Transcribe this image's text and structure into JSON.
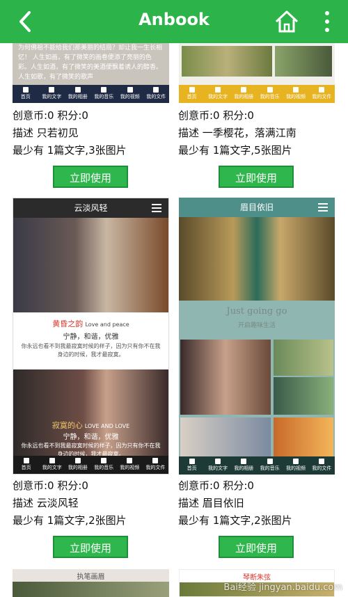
{
  "app": {
    "title": "Anbook"
  },
  "colors": {
    "header": "#2cb34a",
    "button": "#2fb64c"
  },
  "icons": {
    "back": "chevron-left-icon",
    "home": "home-icon",
    "more": "more-vert-icon"
  },
  "template_nav": [
    "首页",
    "我的文字",
    "我的相册",
    "我的音乐",
    "我的视频",
    "我的文件"
  ],
  "top_partial_text": "为何佛祖不能给我们那美丽的结局？却让我一生长相忆！ 人生如画，有了微笑的画卷便添了亮丽的色彩。人生如酒，有了微笑的美酒便飘着诱人的醇香。人生如歌，有了微笑的歌声",
  "cards": [
    {
      "credits": "创意币:0 积分:0",
      "desc": "描述 只若初见",
      "req": "最少有 1篇文字,3张图片",
      "button": "立即使用"
    },
    {
      "credits": "创意币:0 积分:0",
      "desc": "描述 一季樱花，落满江南",
      "req": "最少有 1篇文字,5张图片",
      "button": "立即使用"
    },
    {
      "credits": "创意币:0 积分:0",
      "desc": "描述 云淡风轻",
      "req": "最少有 1篇文字,2张图片",
      "button": "立即使用",
      "preview": {
        "header": "云淡风轻",
        "headline_red": "黄昏之韵",
        "headline_en": "Love and peace",
        "tagline": "宁静，和谐，优雅",
        "body": "你永远也看不到我最寂寞时候的样子，因为只有你不在我身边的时候，我才最寂寞。",
        "overlay_title": "寂寞的心",
        "overlay_en": "LOVE AND LOVE",
        "overlay_tagline": "宁静，和谐，优雅",
        "overlay_body": "你永远也看不到我最寂寞时候的样子，因为只有你不在我身边的时候，我才最寂寞。"
      }
    },
    {
      "credits": "创意币:0 积分:0",
      "desc": "描述 眉目依旧",
      "req": "最少有 1篇文字,2张图片",
      "button": "立即使用",
      "preview": {
        "header": "眉目依旧",
        "script": "Just going go",
        "subtitle": "开启趣味生活"
      }
    }
  ],
  "bottom_partial": {
    "left_header": "执笔画眉",
    "right_header": "琴断朱弦"
  },
  "watermark": "Bai经验 jingyan.baidu.com"
}
